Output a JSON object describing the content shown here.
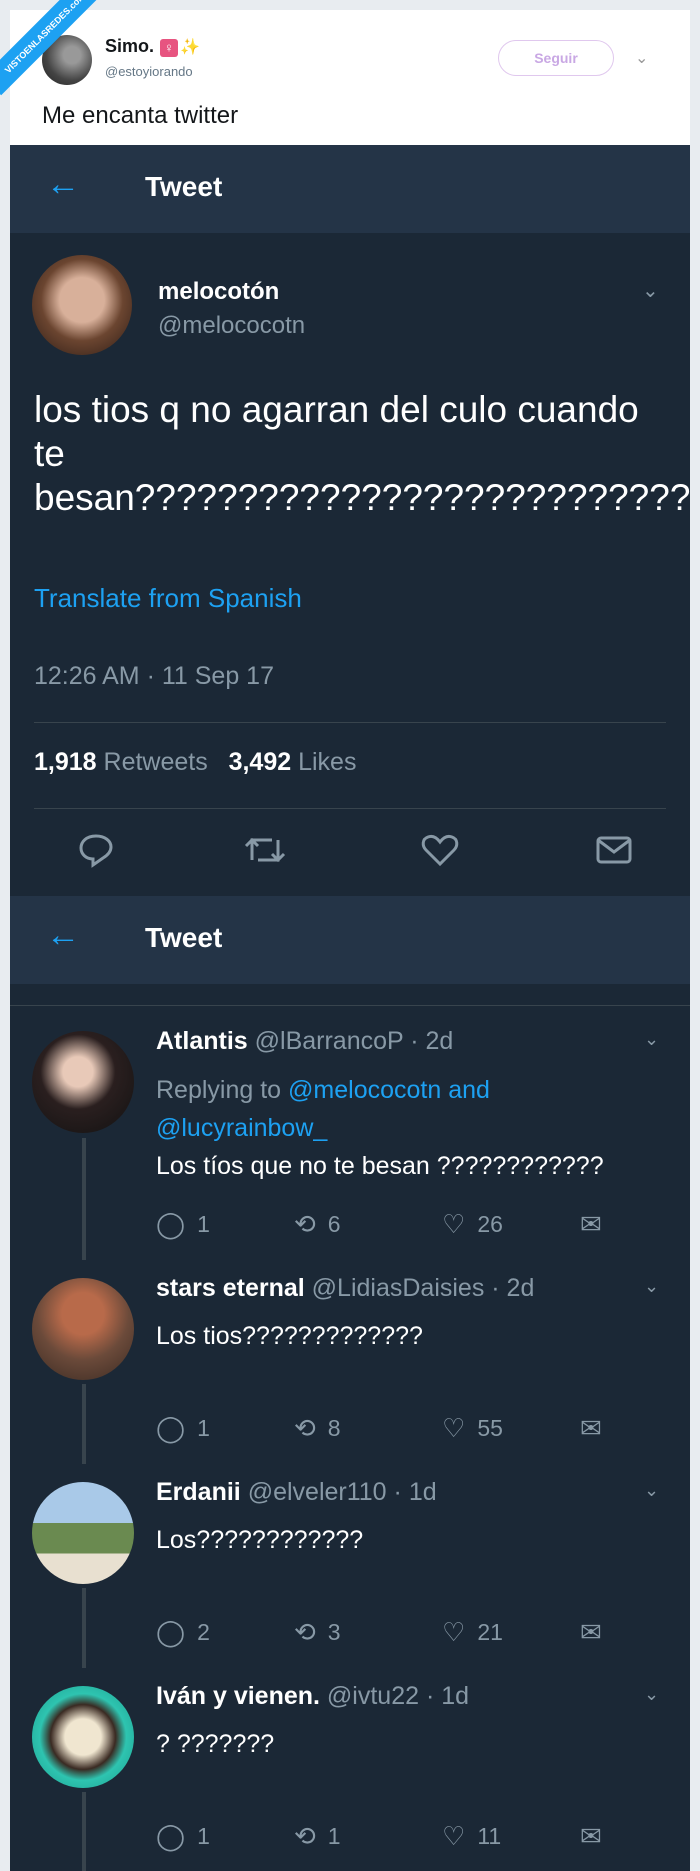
{
  "watermark": "VISTOENLASREDES.com",
  "outer": {
    "name": "Simo.",
    "emoji": "♀",
    "sparkle": "✨",
    "handle": "@estoyiorando",
    "follow_label": "Seguir",
    "tweet_text": "Me encanta twitter"
  },
  "nav": {
    "title": "Tweet"
  },
  "main_tweet": {
    "name": "melocotón",
    "handle": "@melococotn",
    "text": "los tios q no agarran del culo cuando te besan??????????????????????????????",
    "translate": "Translate from Spanish",
    "timestamp": "12:26 AM · 11 Sep 17",
    "retweets_count": "1,918",
    "retweets_label": "Retweets",
    "likes_count": "3,492",
    "likes_label": "Likes"
  },
  "replies": [
    {
      "name": "Atlantis",
      "handle": "@lBarrancoP",
      "time": "· 2d",
      "replying_to": "Replying to",
      "mention1": "@melococotn and",
      "mention2": "@lucyrainbow_",
      "text": "Los tíos que no te besan ????????????",
      "replies": "1",
      "retweets": "6",
      "likes": "26"
    },
    {
      "name": "stars eternal",
      "handle": "@LidiasDaisies",
      "time": "· 2d",
      "text": "Los tios?????????????",
      "replies": "1",
      "retweets": "8",
      "likes": "55"
    },
    {
      "name": "Erdanii",
      "handle": "@elveler110",
      "time": "· 1d",
      "text": "Los????????????",
      "replies": "2",
      "retweets": "3",
      "likes": "21"
    },
    {
      "name": "Iván y vienen.",
      "handle": "@ivtu22",
      "time": "· 1d",
      "text": "? ???????",
      "replies": "1",
      "retweets": "1",
      "likes": "11"
    }
  ]
}
